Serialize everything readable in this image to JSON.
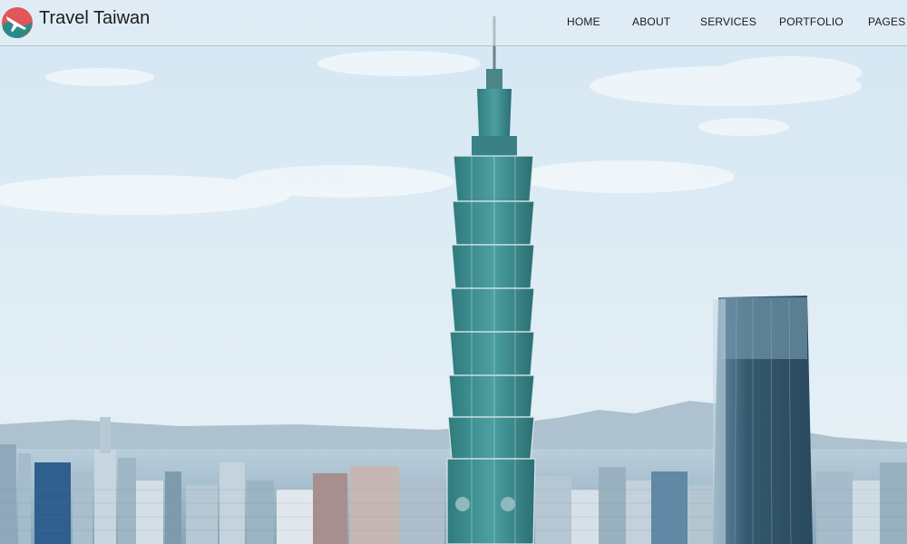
{
  "header": {
    "brand": "Travel Taiwan",
    "logo_icon": "airplane-globe-logo-icon"
  },
  "nav": {
    "items": [
      {
        "label": "HOME"
      },
      {
        "label": "ABOUT"
      },
      {
        "label": "SERVICES"
      },
      {
        "label": "PORTFOLIO"
      },
      {
        "label": "PAGES"
      }
    ]
  },
  "hero": {
    "subject": "Taipei skyline with Taipei 101"
  },
  "colors": {
    "sky": "#dcebf4",
    "tower": "#3c8c8e",
    "logo_teal": "#2a8a86",
    "logo_red": "#e0565b"
  }
}
